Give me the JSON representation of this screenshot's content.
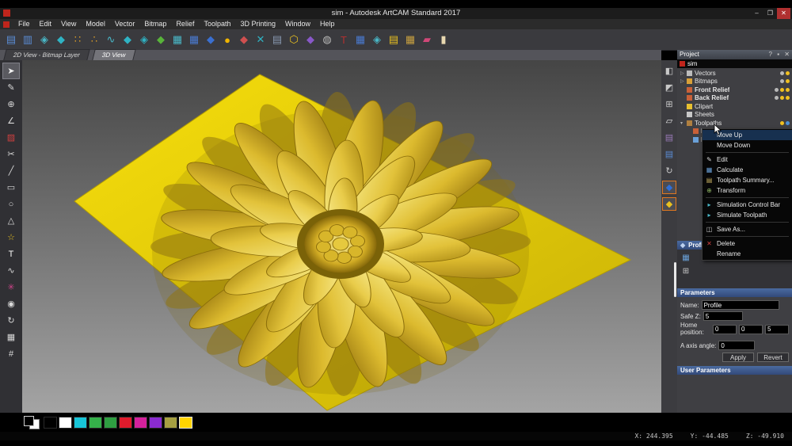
{
  "window": {
    "title": "sim - Autodesk ArtCAM Standard 2017",
    "controls": {
      "min": "–",
      "max": "❐",
      "close": "✕"
    }
  },
  "menu": {
    "items": [
      "File",
      "Edit",
      "View",
      "Model",
      "Vector",
      "Bitmap",
      "Relief",
      "Toolpath",
      "3D Printing",
      "Window",
      "Help"
    ]
  },
  "toolbar": {
    "icons": [
      {
        "name": "model-view-icon",
        "glyph": "▤",
        "color": "#5b8dd6"
      },
      {
        "name": "preview-icon",
        "glyph": "▥",
        "color": "#5b8dd6"
      },
      {
        "name": "spin-model-icon",
        "glyph": "◈",
        "color": "#49b8c8"
      },
      {
        "name": "relief-diamond-teal-icon",
        "glyph": "◆",
        "color": "#2fb3c4"
      },
      {
        "name": "dots-grid-icon",
        "glyph": "∷",
        "color": "#e0a028"
      },
      {
        "name": "node-points-icon",
        "glyph": "∴",
        "color": "#e0a028"
      },
      {
        "name": "wave-profile-icon",
        "glyph": "∿",
        "color": "#49b8c8"
      },
      {
        "name": "relief-teal-icon",
        "glyph": "◆",
        "color": "#2fb3c4"
      },
      {
        "name": "relief-pair-icon",
        "glyph": "◈",
        "color": "#2fb3c4"
      },
      {
        "name": "relief-green-icon",
        "glyph": "◆",
        "color": "#58b33a"
      },
      {
        "name": "layers-teal-icon",
        "glyph": "▦",
        "color": "#49b8c8"
      },
      {
        "name": "layers-blue-icon",
        "glyph": "▦",
        "color": "#4a7ad0"
      },
      {
        "name": "relief-blue-icon",
        "glyph": "◆",
        "color": "#3a6fd0"
      },
      {
        "name": "droplet-icon",
        "glyph": "●",
        "color": "#f0b400"
      },
      {
        "name": "relief-red-icon",
        "glyph": "◆",
        "color": "#d05050"
      },
      {
        "name": "cross-teal-icon",
        "glyph": "✕",
        "color": "#2fb3c4"
      },
      {
        "name": "stack-icon",
        "glyph": "▤",
        "color": "#8898b0"
      },
      {
        "name": "honeycomb-icon",
        "glyph": "⬡",
        "color": "#e8c020"
      },
      {
        "name": "relief-purple-icon",
        "glyph": "◆",
        "color": "#8858c8"
      },
      {
        "name": "dome-icon",
        "glyph": "◍",
        "color": "#b8b8b8"
      },
      {
        "name": "text-relief-icon",
        "glyph": "T",
        "color": "#b03030"
      },
      {
        "name": "blue-stack-icon",
        "glyph": "▦",
        "color": "#4a7ad0"
      },
      {
        "name": "teal-stack-icon",
        "glyph": "◈",
        "color": "#49b8c8"
      },
      {
        "name": "yellow-stack-icon",
        "glyph": "▤",
        "color": "#e8c020"
      },
      {
        "name": "checker-icon",
        "glyph": "▦",
        "color": "#c8a040"
      },
      {
        "name": "pink-plate-icon",
        "glyph": "▰",
        "color": "#d04878"
      },
      {
        "name": "vase-icon",
        "glyph": "▮",
        "color": "#e8d8b0"
      }
    ]
  },
  "tabs": [
    {
      "label": "2D View - Bitmap Layer"
    },
    {
      "label": "3D View"
    }
  ],
  "left_tools": {
    "icons": [
      {
        "name": "select-tool",
        "glyph": "➤",
        "color": "#f0f0f0",
        "selected": true
      },
      {
        "name": "node-edit-tool",
        "glyph": "✎",
        "color": "#d8d8d8"
      },
      {
        "name": "transform-tool",
        "glyph": "⊕",
        "color": "#d8d8d8"
      },
      {
        "name": "measure-tool",
        "glyph": "∠",
        "color": "#d8d8d8"
      },
      {
        "name": "paint-tool",
        "glyph": "▨",
        "color": "#d04040"
      },
      {
        "name": "trim-tool",
        "glyph": "✂",
        "color": "#d8d8d8"
      },
      {
        "name": "line-tool",
        "glyph": "╱",
        "color": "#d8d8d8"
      },
      {
        "name": "rectangle-tool",
        "glyph": "▭",
        "color": "#d8d8d8"
      },
      {
        "name": "circle-tool",
        "glyph": "○",
        "color": "#d8d8d8"
      },
      {
        "name": "polygon-tool",
        "glyph": "△",
        "color": "#d8d8d8"
      },
      {
        "name": "star-tool",
        "glyph": "☆",
        "color": "#e8c020"
      },
      {
        "name": "text-tool",
        "glyph": "T",
        "color": "#ffffff"
      },
      {
        "name": "curve-tool",
        "glyph": "∿",
        "color": "#d8d8d8"
      },
      {
        "name": "bitmap-star-tool",
        "glyph": "✳",
        "color": "#cc4488"
      },
      {
        "name": "target-tool",
        "glyph": "◉",
        "color": "#d8d8d8"
      },
      {
        "name": "spiral-tool",
        "glyph": "↻",
        "color": "#d8d8d8"
      },
      {
        "name": "mesh-tool",
        "glyph": "▦",
        "color": "#d8d8d8"
      },
      {
        "name": "grid-tool",
        "glyph": "#",
        "color": "#d8d8d8"
      }
    ]
  },
  "right_strip": {
    "icons": [
      {
        "name": "isometric-view-icon",
        "glyph": "◧",
        "color": "#c8c8c8"
      },
      {
        "name": "view-cube-icon",
        "glyph": "◩",
        "color": "#c8c8c8"
      },
      {
        "name": "pan-view-icon",
        "glyph": "⊞",
        "color": "#c8c8c8"
      },
      {
        "name": "plane-toggle-icon",
        "glyph": "▱",
        "color": "#e8e8e8"
      },
      {
        "name": "relief-purple-layer-icon",
        "glyph": "▤",
        "color": "#9a7ab8"
      },
      {
        "name": "relief-blue-layer-icon",
        "glyph": "▤",
        "color": "#5b8dd6"
      },
      {
        "name": "rotate-view-icon",
        "glyph": "↻",
        "color": "#c8c8c8"
      },
      {
        "name": "front-relief-layer-icon",
        "glyph": "◆",
        "color": "#2f6fd8",
        "selected": true
      },
      {
        "name": "active-relief-layer-icon",
        "glyph": "◆",
        "color": "#e8c020",
        "selected": true
      }
    ]
  },
  "project_panel": {
    "title": "Project",
    "header_icons": [
      "?",
      "▪",
      "✕"
    ],
    "root": "sim",
    "tree": [
      {
        "label": "Vectors",
        "expand": "▷",
        "icon": "#bcbcbc",
        "trail": [
          "#b8b8b8",
          "#f0c020"
        ]
      },
      {
        "label": "Bitmaps",
        "expand": "▷",
        "icon": "#d8a038",
        "trail": [
          "#b8b8b8",
          "#f0c020"
        ]
      },
      {
        "label": "Front Relief",
        "icon": "#c86038",
        "bold": true,
        "trail": [
          "#b8b8b8",
          "#f0c020",
          "#f0c020"
        ]
      },
      {
        "label": "Back Relief",
        "icon": "#c86038",
        "bold": true,
        "trail": [
          "#b8b8b8",
          "#f0c020",
          "#f0c020"
        ]
      },
      {
        "label": "Clipart",
        "icon": "#e8c030"
      },
      {
        "label": "Sheets",
        "icon": "#c8c8c8"
      },
      {
        "label": "Toolpaths",
        "expand": "▾",
        "icon": "#b08040",
        "trail": [
          "#f0c020",
          "#4a90d8"
        ]
      },
      {
        "label": "Machine Relief",
        "indent": 1,
        "icon": "#c86038",
        "trail": [
          "#f0c020",
          "#4a90d8"
        ]
      },
      {
        "label": "Profile",
        "indent": 1,
        "icon": "#6aa0d8",
        "trail": [
          "#f0c020",
          "#4a90d8"
        ]
      }
    ]
  },
  "context_menu": {
    "items": [
      {
        "label": "Move Up",
        "hl": true,
        "icon": "",
        "icon_name": "move-up"
      },
      {
        "label": "Move Down",
        "icon": "",
        "icon_name": "move-down"
      },
      {
        "type": "sep"
      },
      {
        "label": "Edit",
        "icon": "✎",
        "icon_name": "edit",
        "icon_color": "#d8d8d8"
      },
      {
        "label": "Calculate",
        "icon": "▦",
        "icon_name": "calculate",
        "icon_color": "#6aa0d8"
      },
      {
        "label": "Toolpath Summary...",
        "icon": "▤",
        "icon_name": "toolpath-summary",
        "icon_color": "#c8b060"
      },
      {
        "label": "Transform",
        "icon": "⊕",
        "icon_name": "transform",
        "icon_color": "#8ab060"
      },
      {
        "type": "sep"
      },
      {
        "label": "Simulation Control Bar",
        "icon": "▸",
        "icon_name": "simulation-control-bar",
        "icon_color": "#49b8c8"
      },
      {
        "label": "Simulate Toolpath",
        "icon": "▸",
        "icon_name": "simulate-toolpath",
        "icon_color": "#49b8c8"
      },
      {
        "type": "sep"
      },
      {
        "label": "Save As...",
        "icon": "◫",
        "icon_name": "save-as",
        "icon_color": "#c8c8c8"
      },
      {
        "type": "sep"
      },
      {
        "label": "Delete",
        "icon": "✕",
        "icon_name": "delete",
        "icon_color": "#d04040"
      },
      {
        "label": "Rename",
        "icon": "",
        "icon_name": "rename"
      }
    ]
  },
  "profile_section": {
    "title": "Profile",
    "icons": [
      {
        "name": "toolpath-settings-icon",
        "glyph": "▦",
        "color": "#6aa0d8"
      },
      {
        "name": "calculator-icon",
        "glyph": "⊞",
        "color": "#c8c8c8"
      }
    ]
  },
  "parameters": {
    "title": "Parameters",
    "name_label": "Name:",
    "name_value": "Profile",
    "safe_z_label": "Safe Z:",
    "safe_z_value": "5",
    "home_label": "Home position:",
    "home_x": "0",
    "home_y": "0",
    "home_z": "5",
    "a_axis_label": "A axis angle:",
    "a_axis_value": "0",
    "apply": "Apply",
    "revert": "Revert"
  },
  "user_parameters": {
    "title": "User Parameters"
  },
  "palette": {
    "colors": [
      "dual",
      "#000000",
      "#ffffff",
      "#18c5d8",
      "#35b04a",
      "#2f9e42",
      "#e01b2c",
      "#d4219c",
      "#8a2bd0",
      "#a6a042",
      "#ffd400"
    ],
    "selected_index": 10
  },
  "status_bar": {
    "x": "X: 244.395",
    "y": "Y: -44.485",
    "z": "Z: -49.910"
  }
}
